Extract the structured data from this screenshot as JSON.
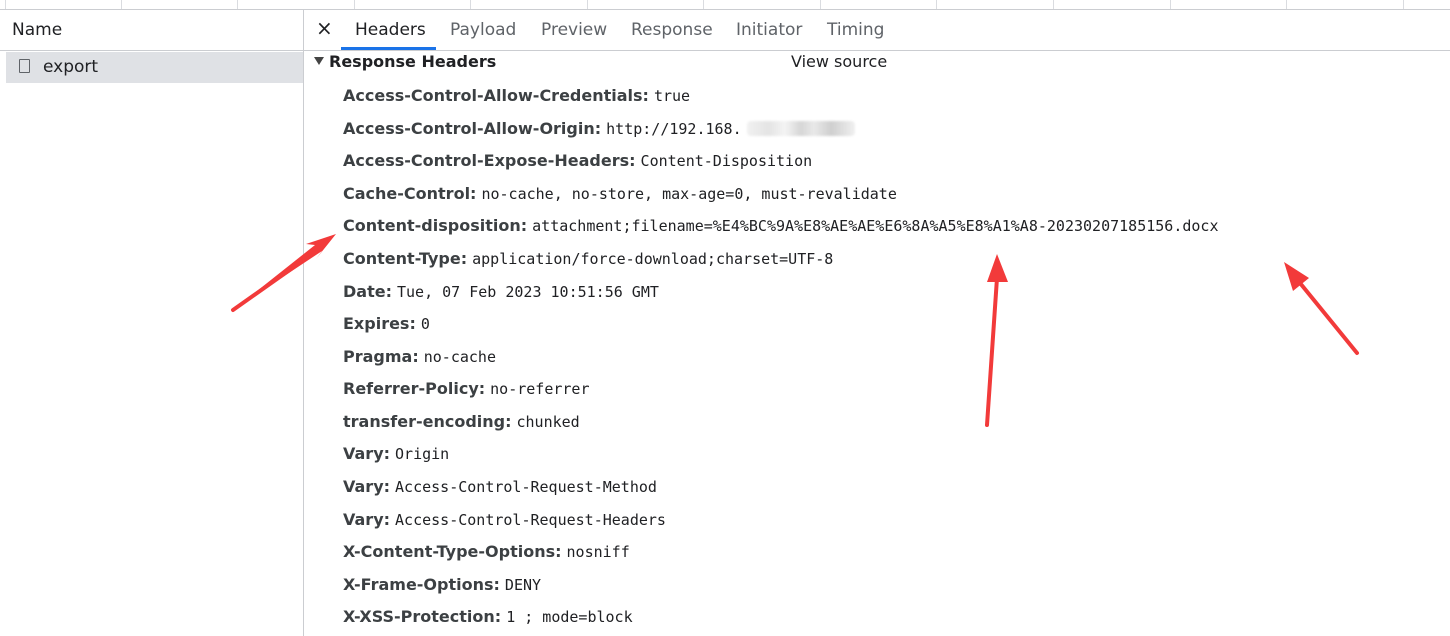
{
  "left_panel": {
    "column_header": "Name",
    "requests": [
      {
        "name": "export"
      }
    ]
  },
  "tabs": [
    {
      "label": "Headers",
      "active": true
    },
    {
      "label": "Payload",
      "active": false
    },
    {
      "label": "Preview",
      "active": false
    },
    {
      "label": "Response",
      "active": false
    },
    {
      "label": "Initiator",
      "active": false
    },
    {
      "label": "Timing",
      "active": false
    }
  ],
  "close_icon": "×",
  "section": {
    "title": "Response Headers",
    "view_source": "View source",
    "expanded": true
  },
  "headers": [
    {
      "name": "Access-Control-Allow-Credentials:",
      "value": "true"
    },
    {
      "name": "Access-Control-Allow-Origin:",
      "value": "http://192.168."
    },
    {
      "name": "Access-Control-Expose-Headers:",
      "value": "Content-Disposition"
    },
    {
      "name": "Cache-Control:",
      "value": "no-cache, no-store, max-age=0, must-revalidate"
    },
    {
      "name": "Content-disposition:",
      "value": "attachment;filename=%E4%BC%9A%E8%AE%AE%E6%8A%A5%E8%A1%A8-20230207185156.docx"
    },
    {
      "name": "Content-Type:",
      "value": "application/force-download;charset=UTF-8"
    },
    {
      "name": "Date:",
      "value": "Tue, 07 Feb 2023 10:51:56 GMT"
    },
    {
      "name": "Expires:",
      "value": "0"
    },
    {
      "name": "Pragma:",
      "value": "no-cache"
    },
    {
      "name": "Referrer-Policy:",
      "value": "no-referrer"
    },
    {
      "name": "transfer-encoding:",
      "value": "chunked"
    },
    {
      "name": "Vary:",
      "value": "Origin"
    },
    {
      "name": "Vary:",
      "value": "Access-Control-Request-Method"
    },
    {
      "name": "Vary:",
      "value": "Access-Control-Request-Headers"
    },
    {
      "name": "X-Content-Type-Options:",
      "value": "nosniff"
    },
    {
      "name": "X-Frame-Options:",
      "value": "DENY"
    },
    {
      "name": "X-XSS-Protection:",
      "value": "1 ; mode=block"
    }
  ],
  "colors": {
    "accent": "#1a73e8",
    "annotation_arrow": "#f23a3a",
    "selected_row": "#dfe1e5"
  }
}
